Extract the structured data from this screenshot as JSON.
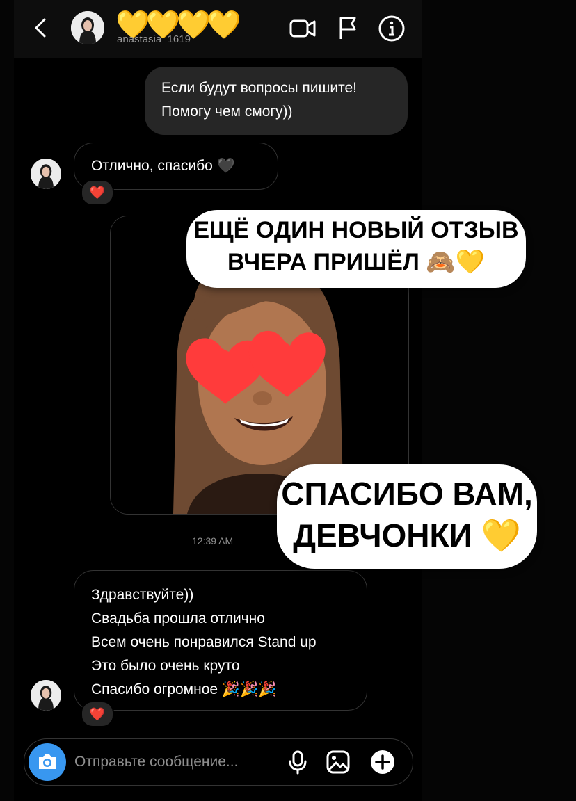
{
  "header": {
    "display_name_hearts": "💛💛💛💛",
    "username": "anastasia_1619",
    "icons": [
      "back-chevron-icon",
      "video-call-icon",
      "flag-icon",
      "info-icon"
    ]
  },
  "messages": {
    "out_1": [
      "Если будут вопросы пишите!",
      "Помогу чем смогу))"
    ],
    "in_1": "Отлично, спасибо 🖤",
    "in_1_reaction": "❤️",
    "timestamp": "12:39 AM",
    "in_2": [
      "Здравствуйте))",
      "Свадьба прошла отлично",
      "Всем очень понравился Stand up",
      "Это было очень круто",
      "Спасибо огромное 🎉🎉🎉"
    ],
    "in_2_reaction": "❤️"
  },
  "stickers": {
    "top": [
      "ЕЩЁ ОДИН НОВЫЙ ОТЗЫВ",
      "ВЧЕРА ПРИШЁЛ 🙈💛"
    ],
    "bottom": [
      "СПАСИБО ВАМ,",
      "ДЕВЧОНКИ 💛"
    ]
  },
  "composer": {
    "placeholder": "Отправьте сообщение..."
  },
  "colors": {
    "background": "#000000",
    "bubble_out": "#262626",
    "accent_camera": "#3897f0",
    "reaction_heart": "#ff3040"
  }
}
